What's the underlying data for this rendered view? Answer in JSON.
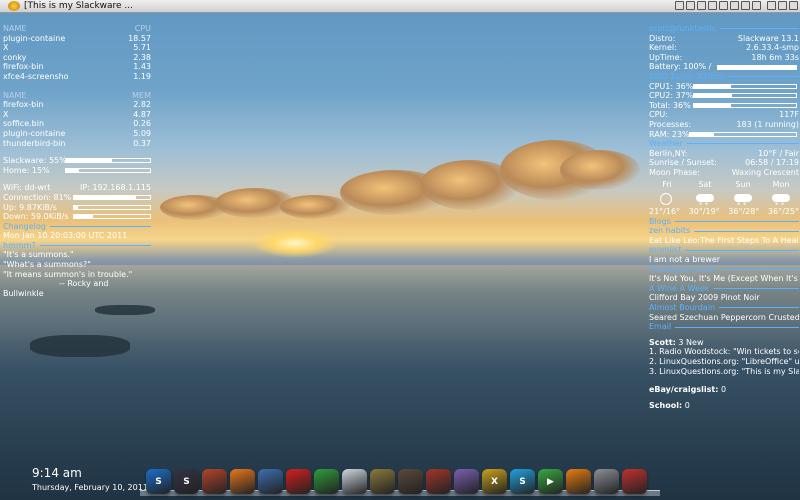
{
  "window": {
    "title": "[This is my Slackware ..."
  },
  "top_cpu": {
    "headers": [
      "NAME",
      "CPU"
    ],
    "rows": [
      [
        "plugin-containe",
        "18.57"
      ],
      [
        "X",
        "5.71"
      ],
      [
        "conky",
        "2.38"
      ],
      [
        "firefox-bin",
        "1.43"
      ],
      [
        "xfce4-screensho",
        "1.19"
      ]
    ]
  },
  "top_mem": {
    "headers": [
      "NAME",
      "MEM"
    ],
    "rows": [
      [
        "firefox-bin",
        "2.82"
      ],
      [
        "X",
        "4.87"
      ],
      [
        "soffice.bin",
        "0.26"
      ],
      [
        "plugin-containe",
        "5.09"
      ],
      [
        "thunderbird-bin",
        "0.37"
      ]
    ]
  },
  "disks": [
    {
      "label": "Slackware: 55%",
      "fill": 0.55
    },
    {
      "label": "Home: 15%",
      "fill": 0.15
    }
  ],
  "network": {
    "wifi": "WiFi: dd-wrt",
    "ip": "IP: 192.168.1.115",
    "connection": {
      "label": "Connection: 81%",
      "fill": 0.81
    },
    "up": {
      "label": "Up: 9.87KiB/s",
      "fill": 0.05
    },
    "down": {
      "label": "Down: 59.0KiB/s",
      "fill": 0.25
    }
  },
  "changelog": {
    "header": "Changelog",
    "date": "Mon Jan 10 20:03:00 UTC 2011"
  },
  "hmmm": {
    "header": "hmmm?",
    "lines": [
      "\"It's a summons.\"",
      "\"What's a summons?\"",
      "\"It means summon's in trouble.\""
    ],
    "attribution": "-- Rocky and",
    "attribution2": "Bullwinkle"
  },
  "system": {
    "header": "scott@funktastic",
    "rows": [
      [
        "Distro:",
        "Slackware 13.1"
      ],
      [
        "Kernel:",
        "2.6.33.4-smp"
      ],
      [
        "UpTime:",
        "18h 6m 33s"
      ]
    ],
    "battery": {
      "label": "Battery: 100% /",
      "fill": 1.0
    }
  },
  "cpu": {
    "header": "AMD Turion X2(tm)",
    "bars": [
      {
        "label": "CPU1: 36%",
        "fill": 0.36
      },
      {
        "label": "CPU2: 37%",
        "fill": 0.37
      },
      {
        "label": "Total: 36%",
        "fill": 0.36
      }
    ],
    "temp_label": "CPU:",
    "temp_value": "117F",
    "processes_label": "Processes:",
    "processes_value": "183 (1 running)",
    "ram": {
      "label": "RAM: 23%",
      "fill": 0.23
    }
  },
  "weather": {
    "header": "Weather",
    "location": "Berlin,NY:",
    "now": "10°F / Fair",
    "sun_label": "Sunrise / Sunset:",
    "sun_value": "06:58 / 17:19",
    "moon_label": "Moon Phase:",
    "moon_value": "Waxing Crescent",
    "days": [
      "Fri",
      "Sat",
      "Sun",
      "Mon"
    ],
    "icons": [
      "sun-icon",
      "snow-cloud-icon",
      "snow-cloud-icon",
      "snow-cloud-icon"
    ],
    "temps": [
      "21°/16°",
      "30°/19°",
      "36°/28°",
      "36°/25°"
    ]
  },
  "blogs": {
    "header": "Blogs",
    "items": [
      {
        "source": "zen habits",
        "title": "Eat Like Leo:The First Steps To A Healt"
      },
      {
        "source": "mnmlist",
        "title": "I am not a brewer"
      },
      {
        "source": "TheOrganicSister",
        "title": "It's Not You, It's Me (Except When It's"
      },
      {
        "source": "A Wine A Week",
        "title": "Clifford Bay 2009 Pinot Noir"
      },
      {
        "source": "Almost Bourdain",
        "title": "Seared Szechuan Peppercorn Crusted"
      }
    ]
  },
  "email": {
    "header": "Email",
    "account": "Scott:",
    "count": "3 New",
    "messages": [
      "1. Radio Woodstock: \"Win tickets to se",
      "2. LinuxQuestions.org: \"LibreOffice\" u",
      "3. LinuxQuestions.org: \"This is my Slac"
    ],
    "other": [
      {
        "label": "eBay/craigslist:",
        "value": "0"
      },
      {
        "label": "School:",
        "value": "0"
      }
    ]
  },
  "clock": {
    "time": "9:14 am",
    "date": "Thursday, February 10, 2011"
  },
  "dock": {
    "icons": [
      {
        "name": "skype-s-icon",
        "color": "#1a6fcc",
        "text": "S"
      },
      {
        "name": "slackware-s-icon",
        "color": "#334",
        "text": "S"
      },
      {
        "name": "tools-icon",
        "color": "#b5442b",
        "text": ""
      },
      {
        "name": "firefox-icon",
        "color": "#e8761b",
        "text": ""
      },
      {
        "name": "thunderbird-icon",
        "color": "#3b6fb0",
        "text": ""
      },
      {
        "name": "opera-icon",
        "color": "#d41f1f",
        "text": ""
      },
      {
        "name": "chrome-icon",
        "color": "#2f9d3c",
        "text": ""
      },
      {
        "name": "files-icon",
        "color": "#cfd7e0",
        "text": ""
      },
      {
        "name": "gimp-icon",
        "color": "#8a7a3b",
        "text": ""
      },
      {
        "name": "music-icon",
        "color": "#5a4a3a",
        "text": ""
      },
      {
        "name": "package-icon",
        "color": "#a3352b",
        "text": ""
      },
      {
        "name": "pidgin-icon",
        "color": "#7a5fb0",
        "text": ""
      },
      {
        "name": "crossover-icon",
        "color": "#c9a21c",
        "text": "X"
      },
      {
        "name": "skype-icon",
        "color": "#1fa3e0",
        "text": "S"
      },
      {
        "name": "media-player-icon",
        "color": "#3aa843",
        "text": "▶"
      },
      {
        "name": "vlc-icon",
        "color": "#e87d10",
        "text": ""
      },
      {
        "name": "disk-icon",
        "color": "#8b8f94",
        "text": ""
      },
      {
        "name": "logout-icon",
        "color": "#c23030",
        "text": ""
      }
    ]
  }
}
